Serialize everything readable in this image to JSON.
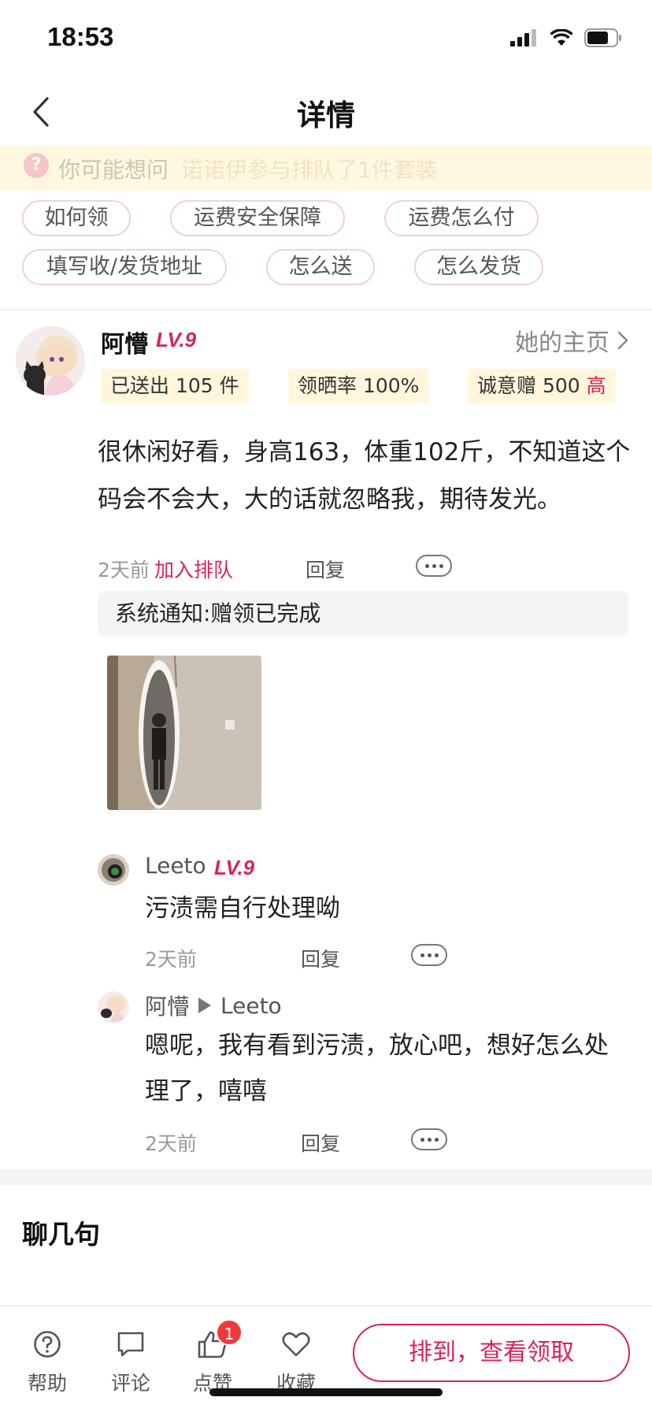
{
  "status_bar": {
    "time": "18:53"
  },
  "nav": {
    "title": "详情"
  },
  "notice": {
    "label": "你可能想问",
    "scrolling_text": "诺诺伊参与排队了1件套装"
  },
  "faq_tags": [
    "如何领",
    "运费安全保障",
    "运费怎么付",
    "填写收/发货地址",
    "怎么送",
    "怎么发货"
  ],
  "post": {
    "author": "阿懵",
    "level": "LV.9",
    "homepage_link": "她的主页",
    "stats": {
      "sent": "已送出 105 件",
      "claim_rate": "领晒率 100%",
      "sincerity_prefix": "诚意赠 500",
      "sincerity_level": "高"
    },
    "text": "很休闲好看，身高163，体重102斤，不知道这个码会不会大，大的话就忽略我，期待发光。",
    "time": "2天前",
    "queue_label": "加入排队",
    "reply_label": "回复",
    "system_note": "系统通知:赠领已完成"
  },
  "comments": [
    {
      "name": "Leeto",
      "level": "LV.9",
      "text": "污渍需自行处理呦",
      "time": "2天前",
      "reply_label": "回复"
    },
    {
      "name": "阿懵",
      "reply_to": "Leeto",
      "text": "嗯呢，我有看到污渍，放心吧，想好怎么处理了，嘻嘻",
      "time": "2天前",
      "reply_label": "回复"
    }
  ],
  "chat_section": {
    "title": "聊几句"
  },
  "bottom_bar": {
    "help": "帮助",
    "comment": "评论",
    "like": "点赞",
    "like_badge": "1",
    "favorite": "收藏",
    "cta": "排到，查看领取"
  },
  "colors": {
    "accent": "#d6245a",
    "notice_bg": "#fff8e1",
    "stat_bg": "#fff6dc"
  }
}
